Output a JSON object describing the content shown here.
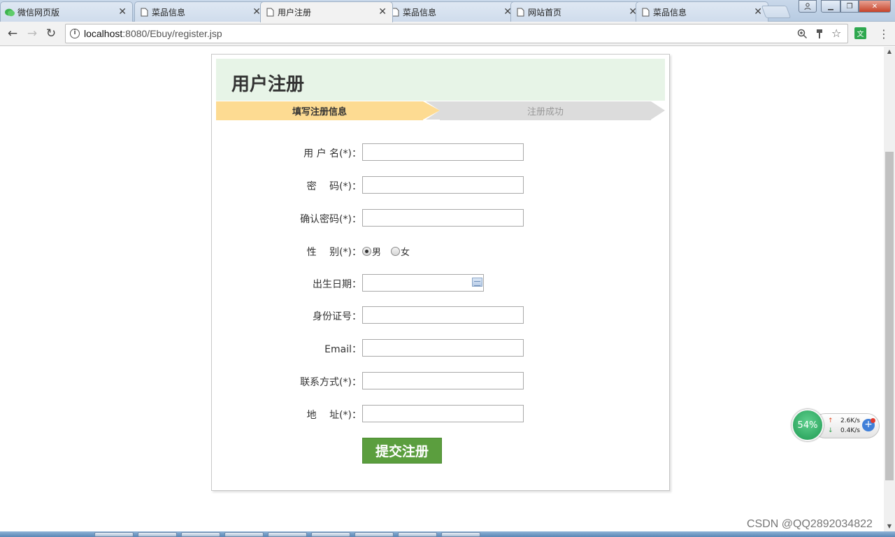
{
  "browser": {
    "tabs": [
      {
        "title": "微信网页版",
        "icon": "wechat-icon",
        "active": false
      },
      {
        "title": "菜品信息",
        "icon": "page-icon",
        "active": false
      },
      {
        "title": "用户注册",
        "icon": "page-icon",
        "active": true
      },
      {
        "title": "菜品信息",
        "icon": "page-icon",
        "active": false
      },
      {
        "title": "网站首页",
        "icon": "page-icon",
        "active": false
      },
      {
        "title": "菜品信息",
        "icon": "page-icon",
        "active": false
      }
    ],
    "url_host": "localhost",
    "url_rest": ":8080/Ebuy/register.jsp",
    "translate_label": "文"
  },
  "page": {
    "title": "用户注册",
    "steps": {
      "step1": "填写注册信息",
      "step2": "注册成功"
    },
    "form": {
      "username_label": "用 户 名(*)：",
      "password_label": "密　 码(*)：",
      "confirm_label": "确认密码(*)：",
      "gender_label": "性　 别(*)：",
      "gender_male": "男",
      "gender_female": "女",
      "birth_label": "出生日期：",
      "idcard_label": "身份证号：",
      "email_label": "Email：",
      "phone_label": "联系方式(*)：",
      "address_label": "地　 址(*)：",
      "submit_label": "提交注册"
    }
  },
  "widget": {
    "percent": "54%",
    "upload": "2.6K/s",
    "download": "0.4K/s"
  },
  "watermark": "CSDN @QQ2892034822"
}
